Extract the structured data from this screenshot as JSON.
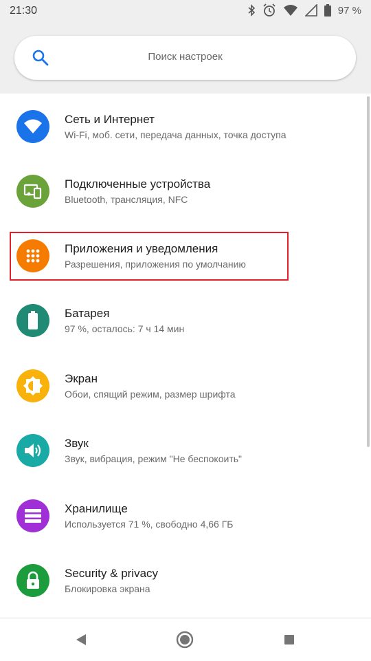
{
  "status_bar": {
    "time": "21:30",
    "battery_percent": "97 %",
    "icons": [
      "bluetooth-icon",
      "alarm-icon",
      "wifi-icon",
      "battery-icon"
    ]
  },
  "search": {
    "placeholder": "Поиск настроек"
  },
  "settings": [
    {
      "title": "Сеть и Интернет",
      "subtitle": "Wi-Fi, моб. сети, передача данных, точка доступа",
      "icon": "wifi-icon",
      "color": "#1a73e8"
    },
    {
      "title": "Подключенные устройства",
      "subtitle": "Bluetooth, трансляция, NFC",
      "icon": "devices-icon",
      "color": "#6aa33a"
    },
    {
      "title": "Приложения и уведомления",
      "subtitle": "Разрешения, приложения по умолчанию",
      "icon": "apps-grid-icon",
      "color": "#f57c00"
    },
    {
      "title": "Батарея",
      "subtitle": "97 %, осталось: 7 ч 14 мин",
      "icon": "battery-icon",
      "color": "#208a74"
    },
    {
      "title": "Экран",
      "subtitle": "Обои, спящий режим, размер шрифта",
      "icon": "brightness-icon",
      "color": "#f9b10b"
    },
    {
      "title": "Звук",
      "subtitle": "Звук, вибрация, режим \"Не беспокоить\"",
      "icon": "volume-icon",
      "color": "#19aaa6"
    },
    {
      "title": "Хранилище",
      "subtitle": "Используется 71 %, свободно 4,66 ГБ",
      "icon": "storage-icon",
      "color": "#a02fd6"
    },
    {
      "title": "Security & privacy",
      "subtitle": "Блокировка экрана",
      "icon": "lock-icon",
      "color": "#1c9c3c"
    }
  ],
  "navbar": {
    "buttons": [
      "back-icon",
      "home-icon",
      "recents-icon"
    ]
  }
}
